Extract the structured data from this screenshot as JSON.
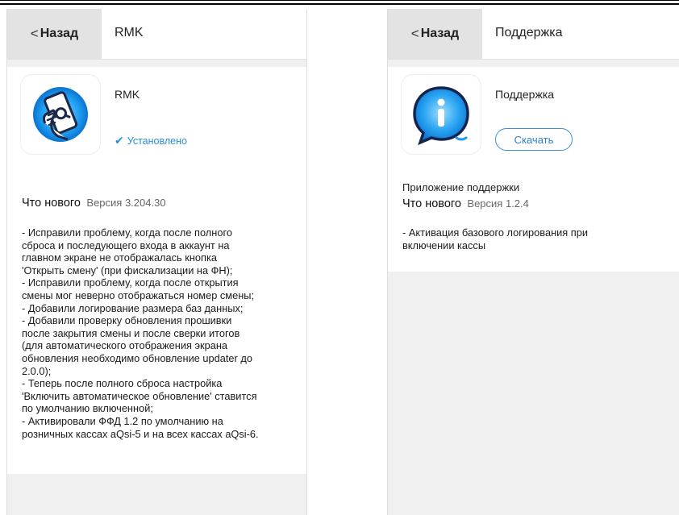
{
  "screens": {
    "left": {
      "header": {
        "back_chevron": "<",
        "back_label": "Назад",
        "title": "RMK"
      },
      "app": {
        "icon": "phone-hand-icon",
        "name": "RMK",
        "status_check": "✔",
        "status": "Установлено"
      },
      "whats_new": {
        "label": "Что нового",
        "version": "Версия 3.204.30",
        "notes": "- Исправили проблему, когда после полного\nсброса и последующего входа в аккаунт на\nглавном экране не отображалась кнопка\n'Открыть смену' (при фискализации на ФН);\n- Исправили проблему, когда после открытия\nсмены мог неверно отображаться номер смены;\n- Добавили логирование размера баз данных;\n- Добавили проверку обновления прошивки\nпосле закрытия смены и после сверки итогов\n(для автоматического отображения экрана\nобновления необходимо обновление updater до\n2.0.0);\n- Теперь после полного сброса настройка\n'Включить автоматическое обновление' ставится\nпо умолчанию включенной;\n- Активировали ФФД 1.2 по умолчанию на\nрозничных кассах aQsi-5 и на всех кассах aQsi-6."
      }
    },
    "right": {
      "header": {
        "back_chevron": "<",
        "back_label": "Назад",
        "title": "Поддержка"
      },
      "app": {
        "icon": "info-chat-icon",
        "name": "Поддержка",
        "download_label": "Скачать"
      },
      "description": "Приложение поддержки",
      "whats_new": {
        "label": "Что нового",
        "version": "Версия 1.2.4",
        "notes": "- Активация базового логирования при\nвключении кассы"
      }
    }
  },
  "colors": {
    "accent": "#2b8fd6",
    "header_back_bg": "#e3e3e3",
    "screen_bg": "#f0f0f0"
  }
}
